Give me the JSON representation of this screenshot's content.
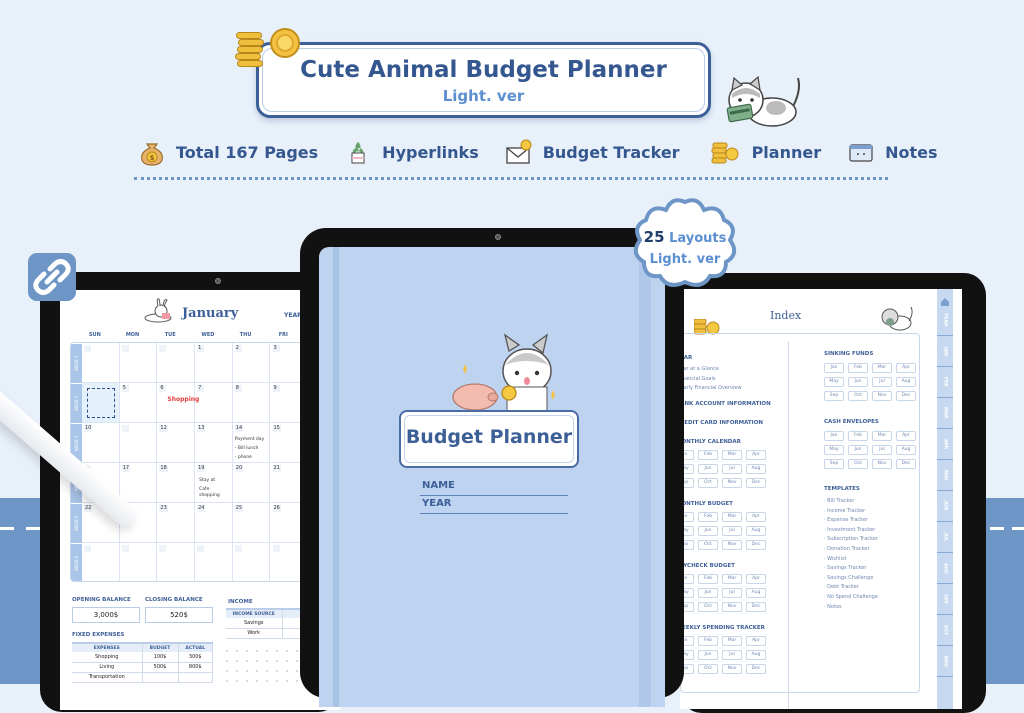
{
  "header": {
    "title": "Cute Animal Budget Planner",
    "subtitle": "Light. ver"
  },
  "features": [
    {
      "icon": "money-bag-icon",
      "label": "Total 167 Pages"
    },
    {
      "icon": "plant-pot-icon",
      "label": "Hyperlinks"
    },
    {
      "icon": "envelope-coin-icon",
      "label": "Budget Tracker"
    },
    {
      "icon": "coins-icon",
      "label": "Planner"
    },
    {
      "icon": "notes-card-icon",
      "label": "Notes"
    }
  ],
  "badge": {
    "count": "25",
    "count_label": "Layouts",
    "version": "Light. ver"
  },
  "calendar_page": {
    "month": "January",
    "year_label": "YEAR",
    "weekdays": [
      "SUN",
      "MON",
      "TUE",
      "WED",
      "THU",
      "FRI"
    ],
    "weeks": [
      "WEEK 1",
      "WEEK 2",
      "WEEK 3",
      "WEEK 4",
      "WEEK 5",
      "WEEK 6"
    ],
    "rows": [
      [
        "",
        "",
        "",
        "1",
        "2",
        "3"
      ],
      [
        "",
        "5",
        "6",
        "7",
        "8",
        "9"
      ],
      [
        "10",
        "",
        "12",
        "13",
        "14",
        "15"
      ],
      [
        "",
        "17",
        "18",
        "19",
        "20",
        "21"
      ],
      [
        "22",
        "",
        "23",
        "24",
        "25",
        "26"
      ],
      [
        "",
        "",
        "",
        "",
        "",
        ""
      ]
    ],
    "notes": {
      "shopping": "Shopping",
      "payment_day": "Payment day",
      "payment_line1": "- Bill lunch",
      "payment_line2": "- phone",
      "day19_line1": "Stay at",
      "day19_line2": "Cafe shopping"
    },
    "opening_balance_label": "OPENING BALANCE",
    "opening_balance": "3,000$",
    "closing_balance_label": "CLOSING BALANCE",
    "closing_balance": "520$",
    "income_label": "INCOME",
    "income_header": "INCOME SOURCE",
    "income_rows": [
      "Savings",
      "Work"
    ],
    "fixed_expenses_label": "FIXED EXPENSES",
    "expense_headers": [
      "EXPENSES",
      "BUDGET",
      "ACTUAL"
    ],
    "expense_rows": [
      [
        "Shopping",
        "100$",
        "300$"
      ],
      [
        "Living",
        "500$",
        "800$"
      ],
      [
        "Transportation",
        "",
        ""
      ]
    ]
  },
  "cover_page": {
    "title": "Budget Planner",
    "name_label": "NAME",
    "year_label": "YEAR"
  },
  "index_page": {
    "title": "Index",
    "left_sections": [
      {
        "title": "YEAR",
        "links": [
          "Year at a Glance",
          "Financial Goals",
          "Yearly Financial Overview"
        ]
      },
      {
        "title": "BANK ACCOUNT INFORMATION",
        "links": []
      },
      {
        "title": "CREDIT CARD INFORMATION",
        "links": []
      },
      {
        "title": "MONTHLY CALENDAR",
        "months": true
      },
      {
        "title": "MONTHLY BUDGET",
        "months": true
      },
      {
        "title": "PAYCHECK BUDGET",
        "months": true
      },
      {
        "title": "WEEKLY SPENDING TRACKER",
        "months": true
      }
    ],
    "sinking_funds": "SINKING FUNDS",
    "cash_envelopes": "CASH ENVELOPES",
    "templates_title": "TEMPLATES",
    "templates": [
      "Bill Tracker",
      "Income Tracker",
      "Expense Tracker",
      "Investment Tracker",
      "Subscription Tracker",
      "Donation Tracker",
      "Wishlist",
      "Savings Tracker",
      "Savings Challenge",
      "Debt Tracker",
      "No Spend Challenge",
      "Notes"
    ],
    "months": [
      "Jan",
      "Feb",
      "Mar",
      "Apr",
      "May",
      "Jun",
      "Jul",
      "Aug",
      "Sep",
      "Oct",
      "Nov",
      "Dec"
    ],
    "side_tabs": [
      "YEAR",
      "JAN",
      "FEB",
      "MAR",
      "APR",
      "MAY",
      "JUN",
      "JUL",
      "AUG",
      "SEP",
      "OCT",
      "NOV"
    ]
  },
  "colors": {
    "background": "#e8f0fa",
    "band": "#6d95c6",
    "primary_text": "#35578f",
    "accent_light": "#5b8fd0",
    "cover": "#bed3ef"
  }
}
